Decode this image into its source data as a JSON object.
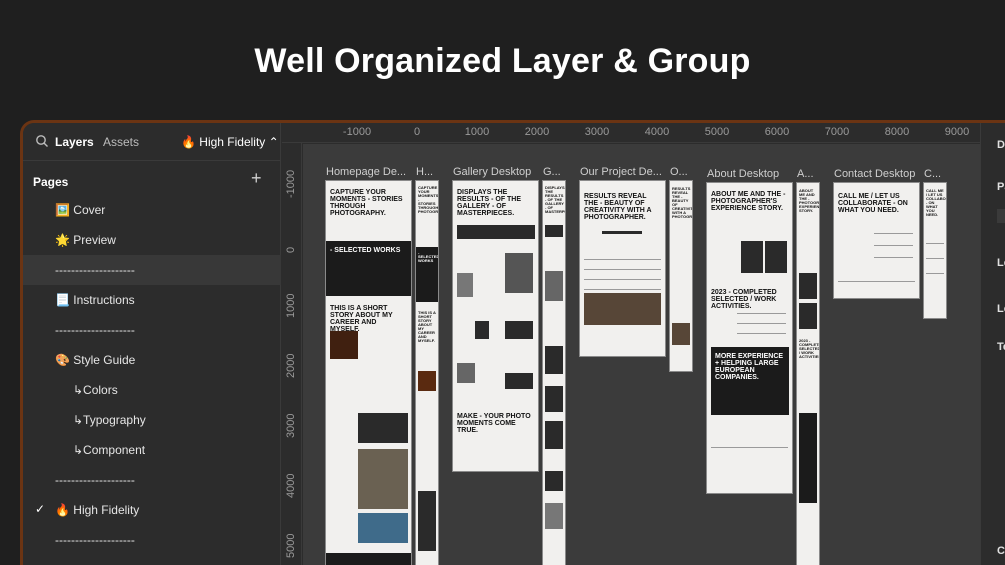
{
  "banner": {
    "title": "Well Organized Layer & Group"
  },
  "sidebar": {
    "tabs": {
      "layers": "Layers",
      "assets": "Assets"
    },
    "current_page": "🔥 High Fidelity ⌃",
    "pages_heading": "Pages",
    "add_label": "+",
    "items": [
      {
        "label": "🖼️ Cover"
      },
      {
        "label": "🌟 Preview"
      },
      {
        "label": "--------------------"
      },
      {
        "label": "📃 Instructions"
      },
      {
        "label": "--------------------"
      },
      {
        "label": "🎨 Style Guide"
      },
      {
        "label": "↳Colors"
      },
      {
        "label": "↳Typography"
      },
      {
        "label": "↳Component"
      },
      {
        "label": "--------------------"
      },
      {
        "label": "🔥 High Fidelity",
        "checked": "✓"
      },
      {
        "label": "--------------------"
      }
    ]
  },
  "ruler": {
    "top": [
      "-1000",
      "0",
      "1000",
      "2000",
      "3000",
      "4000",
      "5000",
      "6000",
      "7000",
      "8000",
      "9000"
    ],
    "left": [
      "-1000",
      "0",
      "1000",
      "2000",
      "3000",
      "4000",
      "5000"
    ]
  },
  "frames": [
    {
      "label": "Homepage De...",
      "h1": "CAPTURE YOUR MOMENTS - STORIES THROUGH PHOTOGRAPHY.",
      "h2": "- SELECTED WORKS",
      "h3": "THIS IS A SHORT STORY ABOUT MY CAREER AND MYSELF."
    },
    {
      "label": "H...",
      "h1": "CAPTURE YOUR MOMENTS - STORIES THROUGH PHOTOGRAPHY.",
      "h2": "- SELECTED WORKS",
      "h3": "THIS IS A SHORT STORY ABOUT MY CAREER AND MYSELF."
    },
    {
      "label": "Gallery Desktop",
      "h1": "DISPLAYS THE RESULTS - OF THE GALLERY - OF MASTERPIECES.",
      "h2": "MAKE - YOUR PHOTO MOMENTS COME TRUE."
    },
    {
      "label": "G...",
      "h1": "DISPLAYS THE RESULTS - OF THE GALLERY - OF MASTERPIECES."
    },
    {
      "label": "Our Project De...",
      "h1": "RESULTS REVEAL THE - BEAUTY OF CREATIVITY WITH A PHOTOGRAPHER."
    },
    {
      "label": "O...",
      "h1": "RESULTS REVEAL THE - BEAUTY OF CREATIVITY WITH A PHOTOGRAPHER."
    },
    {
      "label": "About Desktop",
      "h1": "ABOUT ME AND THE - PHOTOGRAPHER'S EXPERIENCE STORY.",
      "h2": "2023 - COMPLETED SELECTED / WORK ACTIVITIES.",
      "h3": "MORE EXPERIENCE + HELPING LARGE EUROPEAN COMPANIES."
    },
    {
      "label": "A...",
      "h1": "ABOUT ME AND THE - PHOTOGRAPHER'S EXPERIENCE STORY.",
      "h2": "2023 - COMPLETED SELECTED / WORK ACTIVITIES."
    },
    {
      "label": "Contact Desktop",
      "h1": "CALL ME / LET US COLLABORATE - ON WHAT YOU NEED."
    },
    {
      "label": "C...",
      "h1": "CALL ME / LET US COLLABORATE - ON WHAT YOU NEED."
    }
  ],
  "right_panel": {
    "items": [
      "De",
      "Pa",
      "Lo",
      "Lo",
      "Te",
      "Co"
    ]
  },
  "colors": {
    "accent_border": "#6b3413",
    "frame_bg": "#f1f0ee",
    "canvas_bg": "#3b3b3b"
  }
}
